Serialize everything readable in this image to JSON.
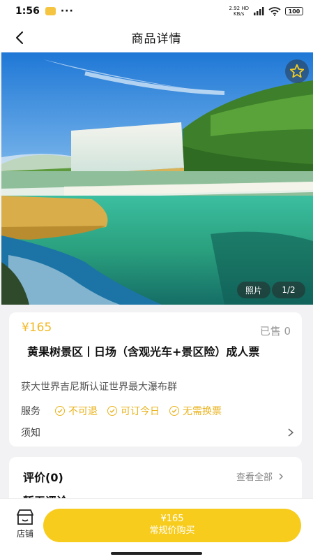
{
  "status_bar": {
    "time": "1:56",
    "more": "···",
    "network_speed": "2.92",
    "network_unit": "KB/s",
    "network_type": "HD",
    "battery": "100"
  },
  "nav": {
    "title": "商品详情"
  },
  "gallery": {
    "photo_label": "照片",
    "counter": "1/2"
  },
  "product": {
    "price": "¥165",
    "sold": "已售 0",
    "title": "黄果树景区丨日场（含观光车+景区险）成人票",
    "subtitle": "获大世界吉尼斯认证世界最大瀑布群",
    "service_label": "服务",
    "services": [
      "不可退",
      "可订今日",
      "无需换票"
    ],
    "notice_label": "须知"
  },
  "reviews": {
    "title": "评价(0)",
    "view_all": "查看全部",
    "empty": "暂无评论"
  },
  "bottom_bar": {
    "store_label": "店铺",
    "buy_price": "¥165",
    "buy_label": "常规价购买"
  },
  "colors": {
    "accent": "#f7cc1d",
    "price": "#f2b823"
  },
  "icons": [
    "back-arrow-icon",
    "star-icon",
    "check-circle-icon",
    "chevron-right-icon",
    "store-icon"
  ]
}
